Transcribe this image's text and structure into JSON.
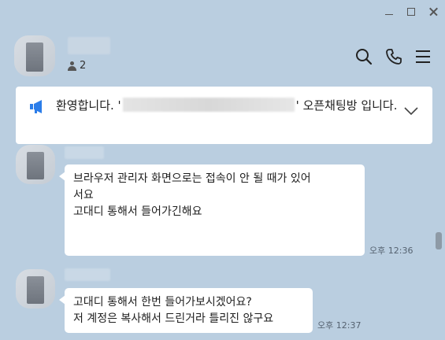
{
  "window": {
    "controls": [
      "minimize",
      "maximize",
      "close"
    ]
  },
  "header": {
    "member_count": "2",
    "actions": [
      "search-icon",
      "phone-icon",
      "menu-icon"
    ]
  },
  "notice": {
    "prefix": "환영합니다. '",
    "suffix": "' 오픈채팅방 입니다."
  },
  "messages": [
    {
      "lines": [
        "브라우저 관리자 화면으로는 접속이 안 될 때가 있어",
        "서요",
        "고대디 통해서 들어가긴해요"
      ],
      "time": "오후 12:36"
    },
    {
      "lines": [
        "고대디 통해서 한번 들어가보시겠어요?",
        "저 계정은 복사해서 드린거라 틀리진 않구요"
      ],
      "time": "오후 12:37"
    }
  ],
  "colors": {
    "background": "#bacee0",
    "bubble": "#ffffff",
    "notice_icon": "#2b7de9"
  }
}
